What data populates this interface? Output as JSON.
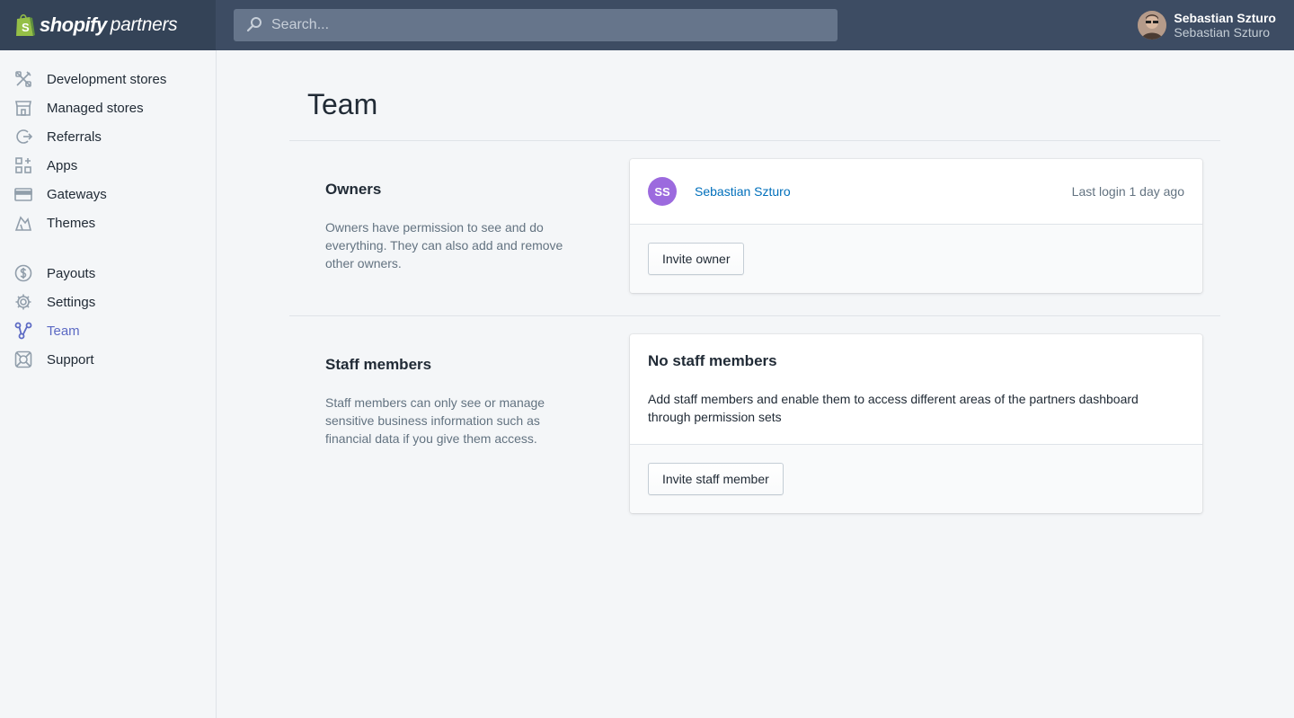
{
  "brand": {
    "name": "shopify",
    "sub": "partners"
  },
  "search": {
    "placeholder": "Search..."
  },
  "user": {
    "name": "Sebastian Szturo",
    "org": "Sebastian Szturo"
  },
  "sidebar": {
    "primary": [
      {
        "label": "Development stores",
        "icon": "development-stores-icon"
      },
      {
        "label": "Managed stores",
        "icon": "managed-stores-icon"
      },
      {
        "label": "Referrals",
        "icon": "referrals-icon"
      },
      {
        "label": "Apps",
        "icon": "apps-icon"
      },
      {
        "label": "Gateways",
        "icon": "gateways-icon"
      },
      {
        "label": "Themes",
        "icon": "themes-icon"
      }
    ],
    "secondary": [
      {
        "label": "Payouts",
        "icon": "payouts-icon"
      },
      {
        "label": "Settings",
        "icon": "settings-icon"
      },
      {
        "label": "Team",
        "icon": "team-icon",
        "active": true
      },
      {
        "label": "Support",
        "icon": "support-icon"
      }
    ]
  },
  "page": {
    "title": "Team"
  },
  "owners": {
    "title": "Owners",
    "description": "Owners have permission to see and do everything. They can also add and remove other owners.",
    "member": {
      "initials": "SS",
      "name": "Sebastian Szturo",
      "last_login": "Last login 1 day ago"
    },
    "button": "Invite owner"
  },
  "staff": {
    "title": "Staff members",
    "description": "Staff members can only see or manage sensitive business information such as financial data if you give them access.",
    "empty_heading": "No staff members",
    "empty_text": "Add staff members and enable them to access different areas of the partners dashboard through permission sets",
    "button": "Invite staff member"
  },
  "colors": {
    "topbar": "#3d4c63",
    "accent": "#5c6ac4",
    "link": "#006fbb",
    "avatar_initials_bg": "#9c6ade",
    "brand_green": "#95bf47"
  }
}
